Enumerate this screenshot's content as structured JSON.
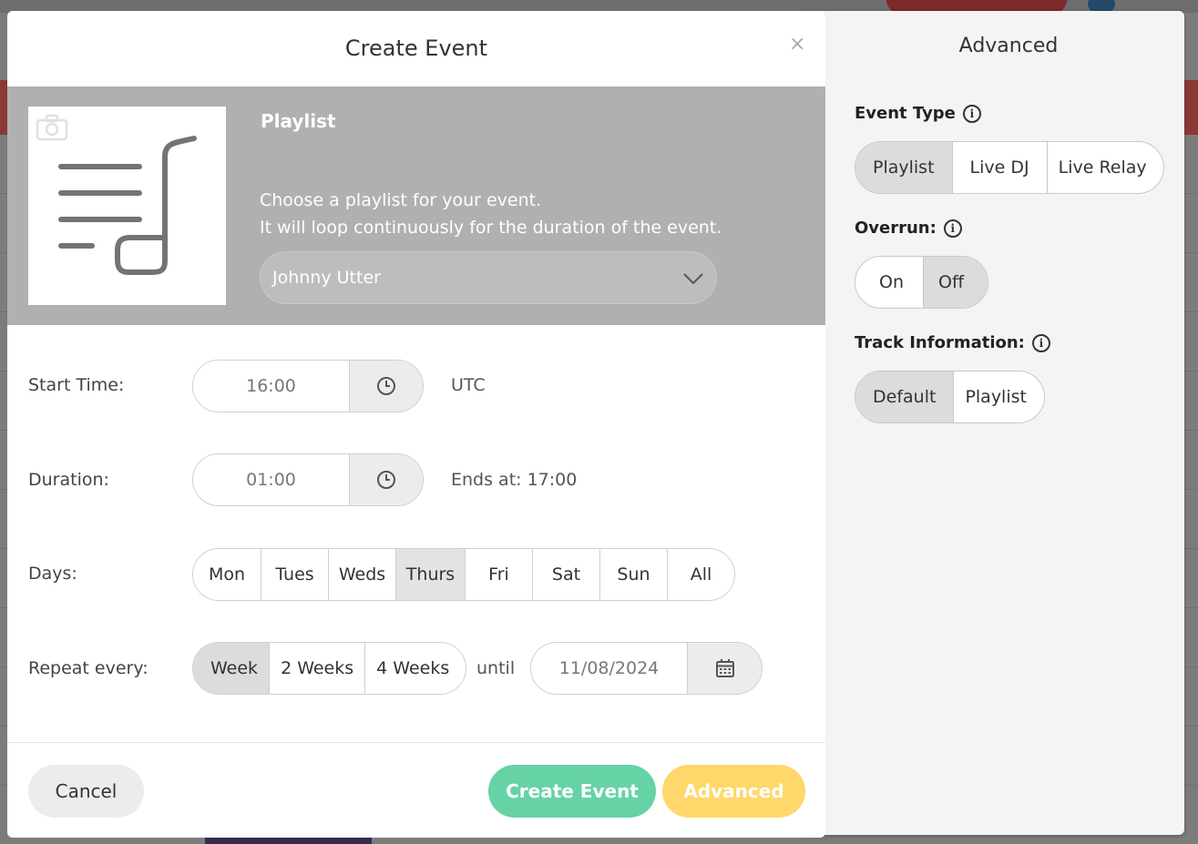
{
  "colors": {
    "create_button": "#66d3a6",
    "advanced_button": "#ffd76a",
    "hero_background": "#b0b0b0",
    "active_segment": "#dcdcdc"
  },
  "modal": {
    "title": "Create Event",
    "close_symbol": "×",
    "hero": {
      "title": "Playlist",
      "description_line1": "Choose a playlist for your event.",
      "description_line2": "It will loop continuously for the duration of the event.",
      "selected_playlist": "Johnny Utter"
    },
    "start_time": {
      "label": "Start Time:",
      "value": "16:00",
      "timezone": "UTC"
    },
    "duration": {
      "label": "Duration:",
      "value": "01:00",
      "ends_at": "Ends at: 17:00"
    },
    "days": {
      "label": "Days:",
      "options": [
        "Mon",
        "Tues",
        "Weds",
        "Thurs",
        "Fri",
        "Sat",
        "Sun",
        "All"
      ],
      "selected": "Thurs"
    },
    "repeat": {
      "label": "Repeat every:",
      "options": [
        "Week",
        "2 Weeks",
        "4 Weeks"
      ],
      "selected": "Week",
      "until_label": "until",
      "until_date": "11/08/2024"
    },
    "footer": {
      "cancel": "Cancel",
      "create": "Create Event",
      "advanced": "Advanced"
    }
  },
  "advanced_panel": {
    "title": "Advanced",
    "event_type": {
      "label": "Event Type",
      "options": [
        "Playlist",
        "Live DJ",
        "Live Relay"
      ],
      "selected": "Playlist"
    },
    "overrun": {
      "label": "Overrun:",
      "options": [
        "On",
        "Off"
      ],
      "selected": "Off"
    },
    "track_info": {
      "label": "Track Information:",
      "options": [
        "Default",
        "Playlist"
      ],
      "selected": "Default"
    }
  }
}
